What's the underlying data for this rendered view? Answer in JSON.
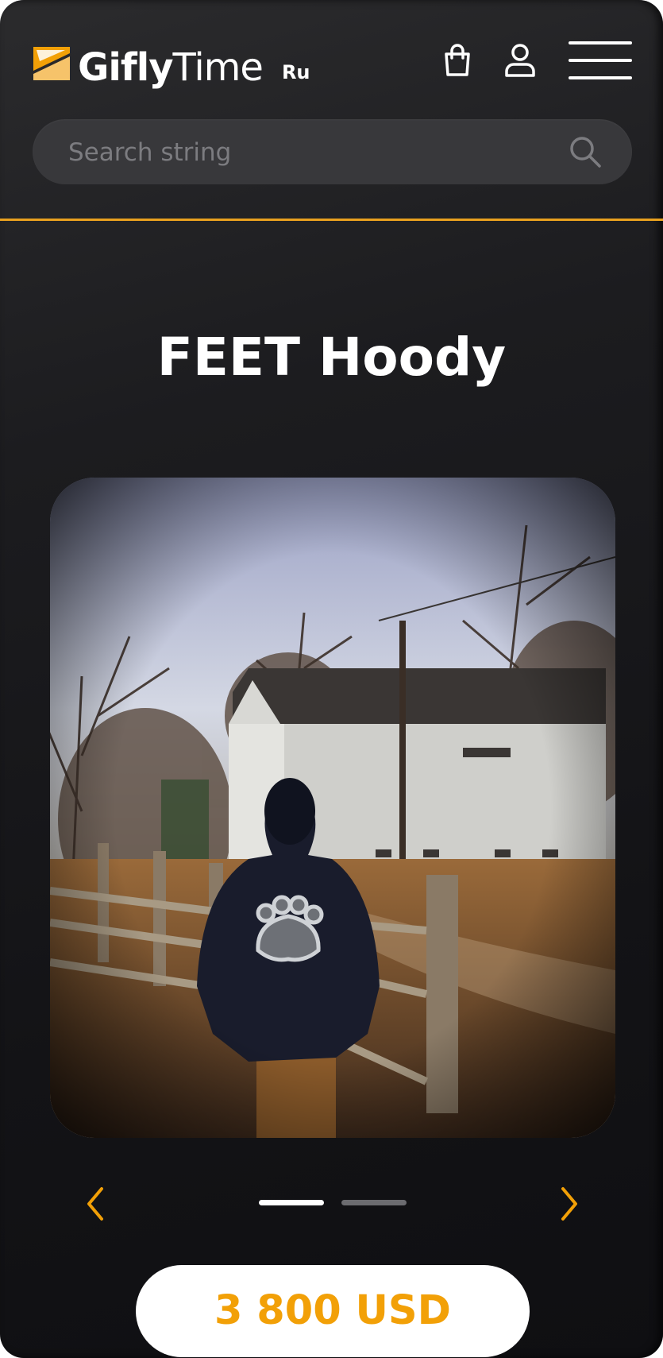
{
  "header": {
    "logo_bold": "Gifly",
    "logo_thin": "Time",
    "language": "Ru",
    "cart_icon": "shopping-bag-icon",
    "user_icon": "user-icon",
    "menu_icon": "hamburger-menu-icon"
  },
  "search": {
    "placeholder": "Search string",
    "value": "",
    "icon": "search-icon"
  },
  "product": {
    "title": "FEET Hoody",
    "image_icon": "product-photo",
    "price": "3 800 USD"
  },
  "carousel": {
    "slide_count": 2,
    "active_index": 0,
    "prev_icon": "chevron-left-icon",
    "next_icon": "chevron-right-icon"
  },
  "colors": {
    "accent": "#f2a007",
    "divider": "#e9a11f",
    "background": "#161619",
    "search_bg": "#38383b"
  }
}
